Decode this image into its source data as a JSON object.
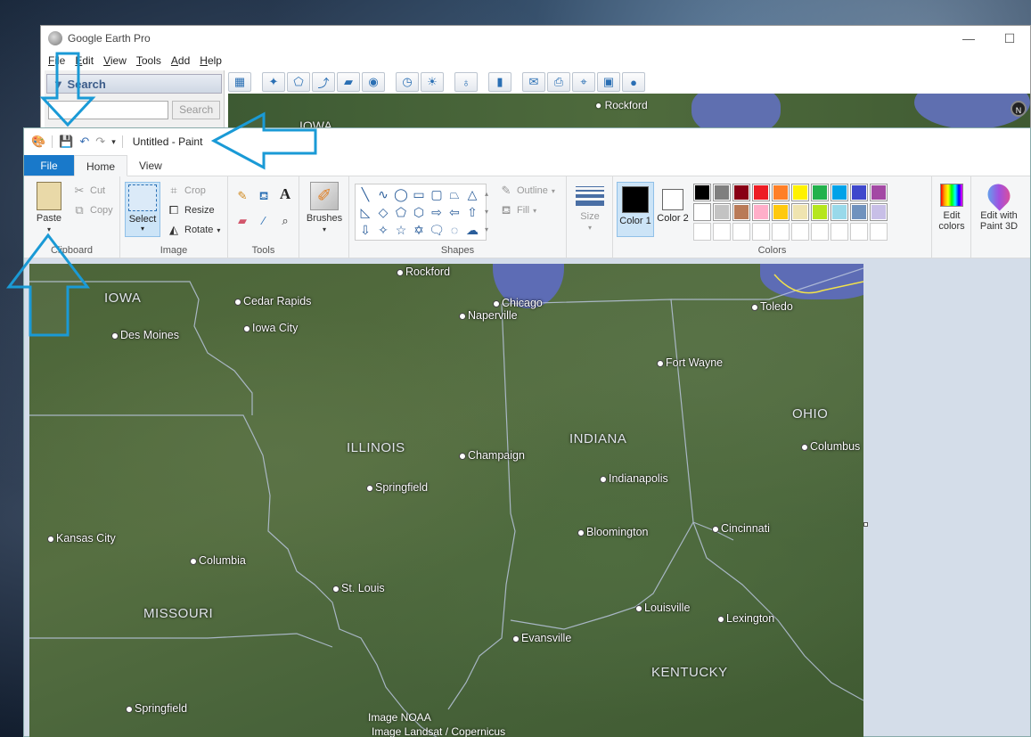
{
  "google_earth": {
    "title": "Google Earth Pro",
    "menu": [
      "File",
      "Edit",
      "View",
      "Tools",
      "Add",
      "Help"
    ],
    "search_label": "Search",
    "search_button": "Search",
    "compass": "N",
    "map_labels": {
      "rockford": "Rockford",
      "iowa": "IOWA"
    }
  },
  "paint": {
    "title": "Untitled - Paint",
    "tabs": {
      "file": "File",
      "home": "Home",
      "view": "View"
    },
    "clipboard": {
      "paste": "Paste",
      "cut": "Cut",
      "copy": "Copy",
      "group": "Clipboard"
    },
    "image": {
      "select": "Select",
      "crop": "Crop",
      "resize": "Resize",
      "rotate": "Rotate",
      "group": "Image"
    },
    "tools": {
      "group": "Tools",
      "text_icon": "A"
    },
    "brushes": {
      "label": "Brushes"
    },
    "shapes": {
      "group": "Shapes",
      "outline": "Outline",
      "fill": "Fill"
    },
    "size": {
      "label": "Size"
    },
    "colors": {
      "color1": "Color 1",
      "color2": "Color 2",
      "color1_value": "#000000",
      "color2_value": "#ffffff",
      "edit": "Edit colors",
      "group": "Colors",
      "palette": [
        "#000000",
        "#7f7f7f",
        "#880015",
        "#ed1c24",
        "#ff7f27",
        "#fff200",
        "#22b14c",
        "#00a2e8",
        "#3f48cc",
        "#a349a4",
        "#ffffff",
        "#c3c3c3",
        "#b97a57",
        "#ffaec9",
        "#ffc90e",
        "#efe4b0",
        "#b5e61d",
        "#99d9ea",
        "#7092be",
        "#c8bfe7"
      ]
    },
    "paint3d": {
      "label": "Edit with Paint 3D"
    },
    "canvas": {
      "cities": [
        "Rockford",
        "Cedar Rapids",
        "Chicago",
        "Naperville",
        "Toledo",
        "Des Moines",
        "Iowa City",
        "Fort Wayne",
        "Columbus",
        "Champaign",
        "Indianapolis",
        "Springfield",
        "Kansas City",
        "Columbia",
        "Bloomington",
        "Cincinnati",
        "St. Louis",
        "Louisville",
        "Lexington",
        "Evansville",
        "Springfield"
      ],
      "states": [
        "IOWA",
        "ILLINOIS",
        "INDIANA",
        "OHIO",
        "MISSOURI",
        "KENTUCKY"
      ],
      "attribution": [
        "Image NOAA",
        "Image Landsat / Copernicus"
      ]
    }
  },
  "annotation_color": "#1a9ad6"
}
